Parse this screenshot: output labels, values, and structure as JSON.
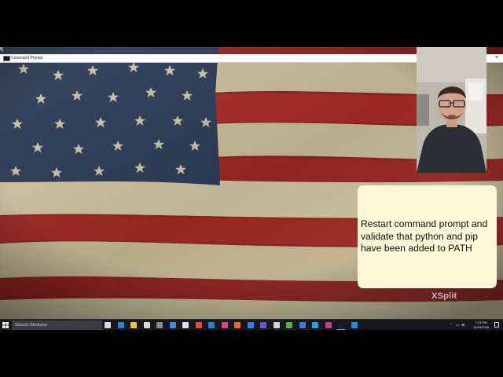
{
  "window": {
    "title": "Command Prompt",
    "close_glyph": "×"
  },
  "note": {
    "text": "Restart command prompt and validate that python and pip have been added to PATH"
  },
  "watermark": "XSplit",
  "taskbar": {
    "search_placeholder": "Search Windows",
    "clock_time": "7:24 PM",
    "clock_date": "11/24/2016",
    "pinned_icons": [
      {
        "name": "task-view-icon",
        "color": "#d9d9d9"
      },
      {
        "name": "edge-icon",
        "color": "#2f7fd1"
      },
      {
        "name": "file-explorer-icon",
        "color": "#e8c547"
      },
      {
        "name": "store-icon",
        "color": "#d9d9d9"
      },
      {
        "name": "calculator-icon",
        "color": "#8a8a8a"
      },
      {
        "name": "snipping-tool-icon",
        "color": "#3a8fd9"
      },
      {
        "name": "paint-icon",
        "color": "#e0e0e0"
      },
      {
        "name": "chrome-icon",
        "color": "#e04a3b"
      },
      {
        "name": "app-icon",
        "color": "#2c7ad6"
      },
      {
        "name": "app-icon-2",
        "color": "#d44a7a"
      },
      {
        "name": "firefox-icon",
        "color": "#e66a1e"
      },
      {
        "name": "app-icon-3",
        "color": "#2f86d8"
      },
      {
        "name": "visual-studio-icon",
        "color": "#7a4fc1"
      },
      {
        "name": "app-icon-4",
        "color": "#d4d4d4"
      },
      {
        "name": "app-icon-5",
        "color": "#4caf50"
      },
      {
        "name": "app-icon-6",
        "color": "#3a7bd5"
      },
      {
        "name": "app-icon-7",
        "color": "#29a3d8"
      },
      {
        "name": "app-icon-8",
        "color": "#c23b9e"
      },
      {
        "name": "command-prompt-icon",
        "color": "#1e1e1e"
      },
      {
        "name": "app-icon-9",
        "color": "#2b88d8"
      }
    ],
    "colors": {
      "bar": "#14181e",
      "search": "#3a3d42",
      "accent": "#7aa7d8"
    }
  }
}
